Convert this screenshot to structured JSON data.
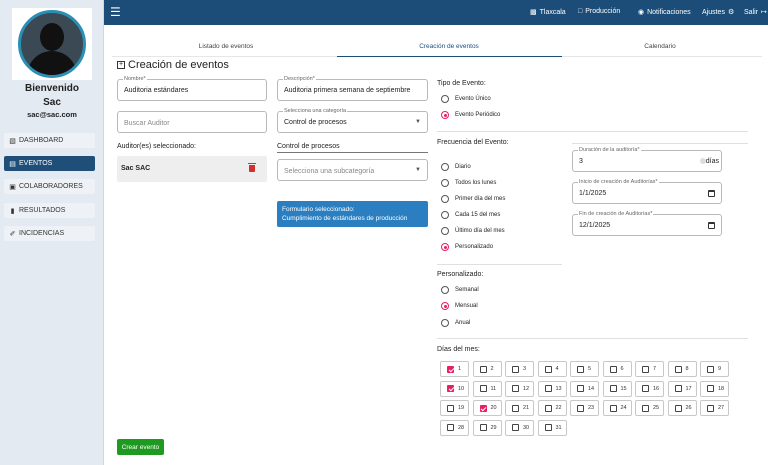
{
  "sidebar": {
    "welcome": "Bienvenido",
    "user": "Sac",
    "email": "sac@sac.com",
    "items": [
      {
        "label": "DASHBOARD",
        "icon": "bar-chart-icon"
      },
      {
        "label": "EVENTOS",
        "icon": "calendar-icon"
      },
      {
        "label": "COLABORADORES",
        "icon": "id-card-icon"
      },
      {
        "label": "RESULTADOS",
        "icon": "clipboard-icon"
      },
      {
        "label": "INCIDENCIAS",
        "icon": "wrench-icon"
      }
    ]
  },
  "topbar": {
    "links": [
      "Tlaxcala",
      "Producción",
      "Notificaciones",
      "Ajustes",
      "Salir"
    ]
  },
  "tabs": [
    "Listado de eventos",
    "Creación de eventos",
    "Calendario"
  ],
  "title": "Creación de eventos",
  "form": {
    "nombre_label": "Nombre*",
    "nombre_value": "Auditoria estándares",
    "descripcion_label": "Descripción*",
    "descripcion_value": "Auditoria primera semana de septiembre",
    "buscar_placeholder": "Buscar Auditor",
    "categoria_label": "Selecciona una categoría",
    "categoria_value": "Control de procesos",
    "auditores_label": "Auditor(es) seleccionado:",
    "auditor_name": "Sac SAC",
    "control_label": "Control de procesos",
    "subcategoria_placeholder": "Selecciona una subcategoría",
    "formulario_line1": "Formulario seleccionado:",
    "formulario_line2": "Cumplimiento de estándares de producción",
    "create_button": "Crear evento"
  },
  "tipo": {
    "label": "Tipo de Evento:",
    "options": [
      "Evento Único",
      "Evento Periódico"
    ],
    "selected": 1
  },
  "frecuencia": {
    "label": "Frecuencia del Evento:",
    "options": [
      "Diario",
      "Todos los lunes",
      "Primer día del mes",
      "Cada 15 del mes",
      "Último día del mes",
      "Personalizado"
    ],
    "selected": 5
  },
  "duracion": {
    "label": "Duración de la auditoría*",
    "value": "3",
    "unit": "días"
  },
  "inicio": {
    "label": "Inicio de creación de Auditorías*",
    "value": "1/1/2025"
  },
  "fin": {
    "label": "Fin de creación de Auditorías*",
    "value": "12/1/2025"
  },
  "personalizado": {
    "label": "Personalizado:",
    "options": [
      "Semanal",
      "Mensual",
      "Anual"
    ],
    "selected": 1
  },
  "dias": {
    "label": "Días del mes:",
    "checked": [
      1,
      10,
      20
    ],
    "values": [
      "1",
      "2",
      "3",
      "4",
      "5",
      "6",
      "7",
      "8",
      "9",
      "10",
      "11",
      "12",
      "13",
      "14",
      "15",
      "16",
      "17",
      "18",
      "19",
      "20",
      "21",
      "22",
      "23",
      "24",
      "25",
      "26",
      "27",
      "28",
      "29",
      "30",
      "31"
    ]
  },
  "colors": {
    "primary": "#1c4d79",
    "accent": "#e91e63",
    "success": "#1e9a20",
    "info": "#2b7fc0",
    "danger": "#d32f2f"
  }
}
